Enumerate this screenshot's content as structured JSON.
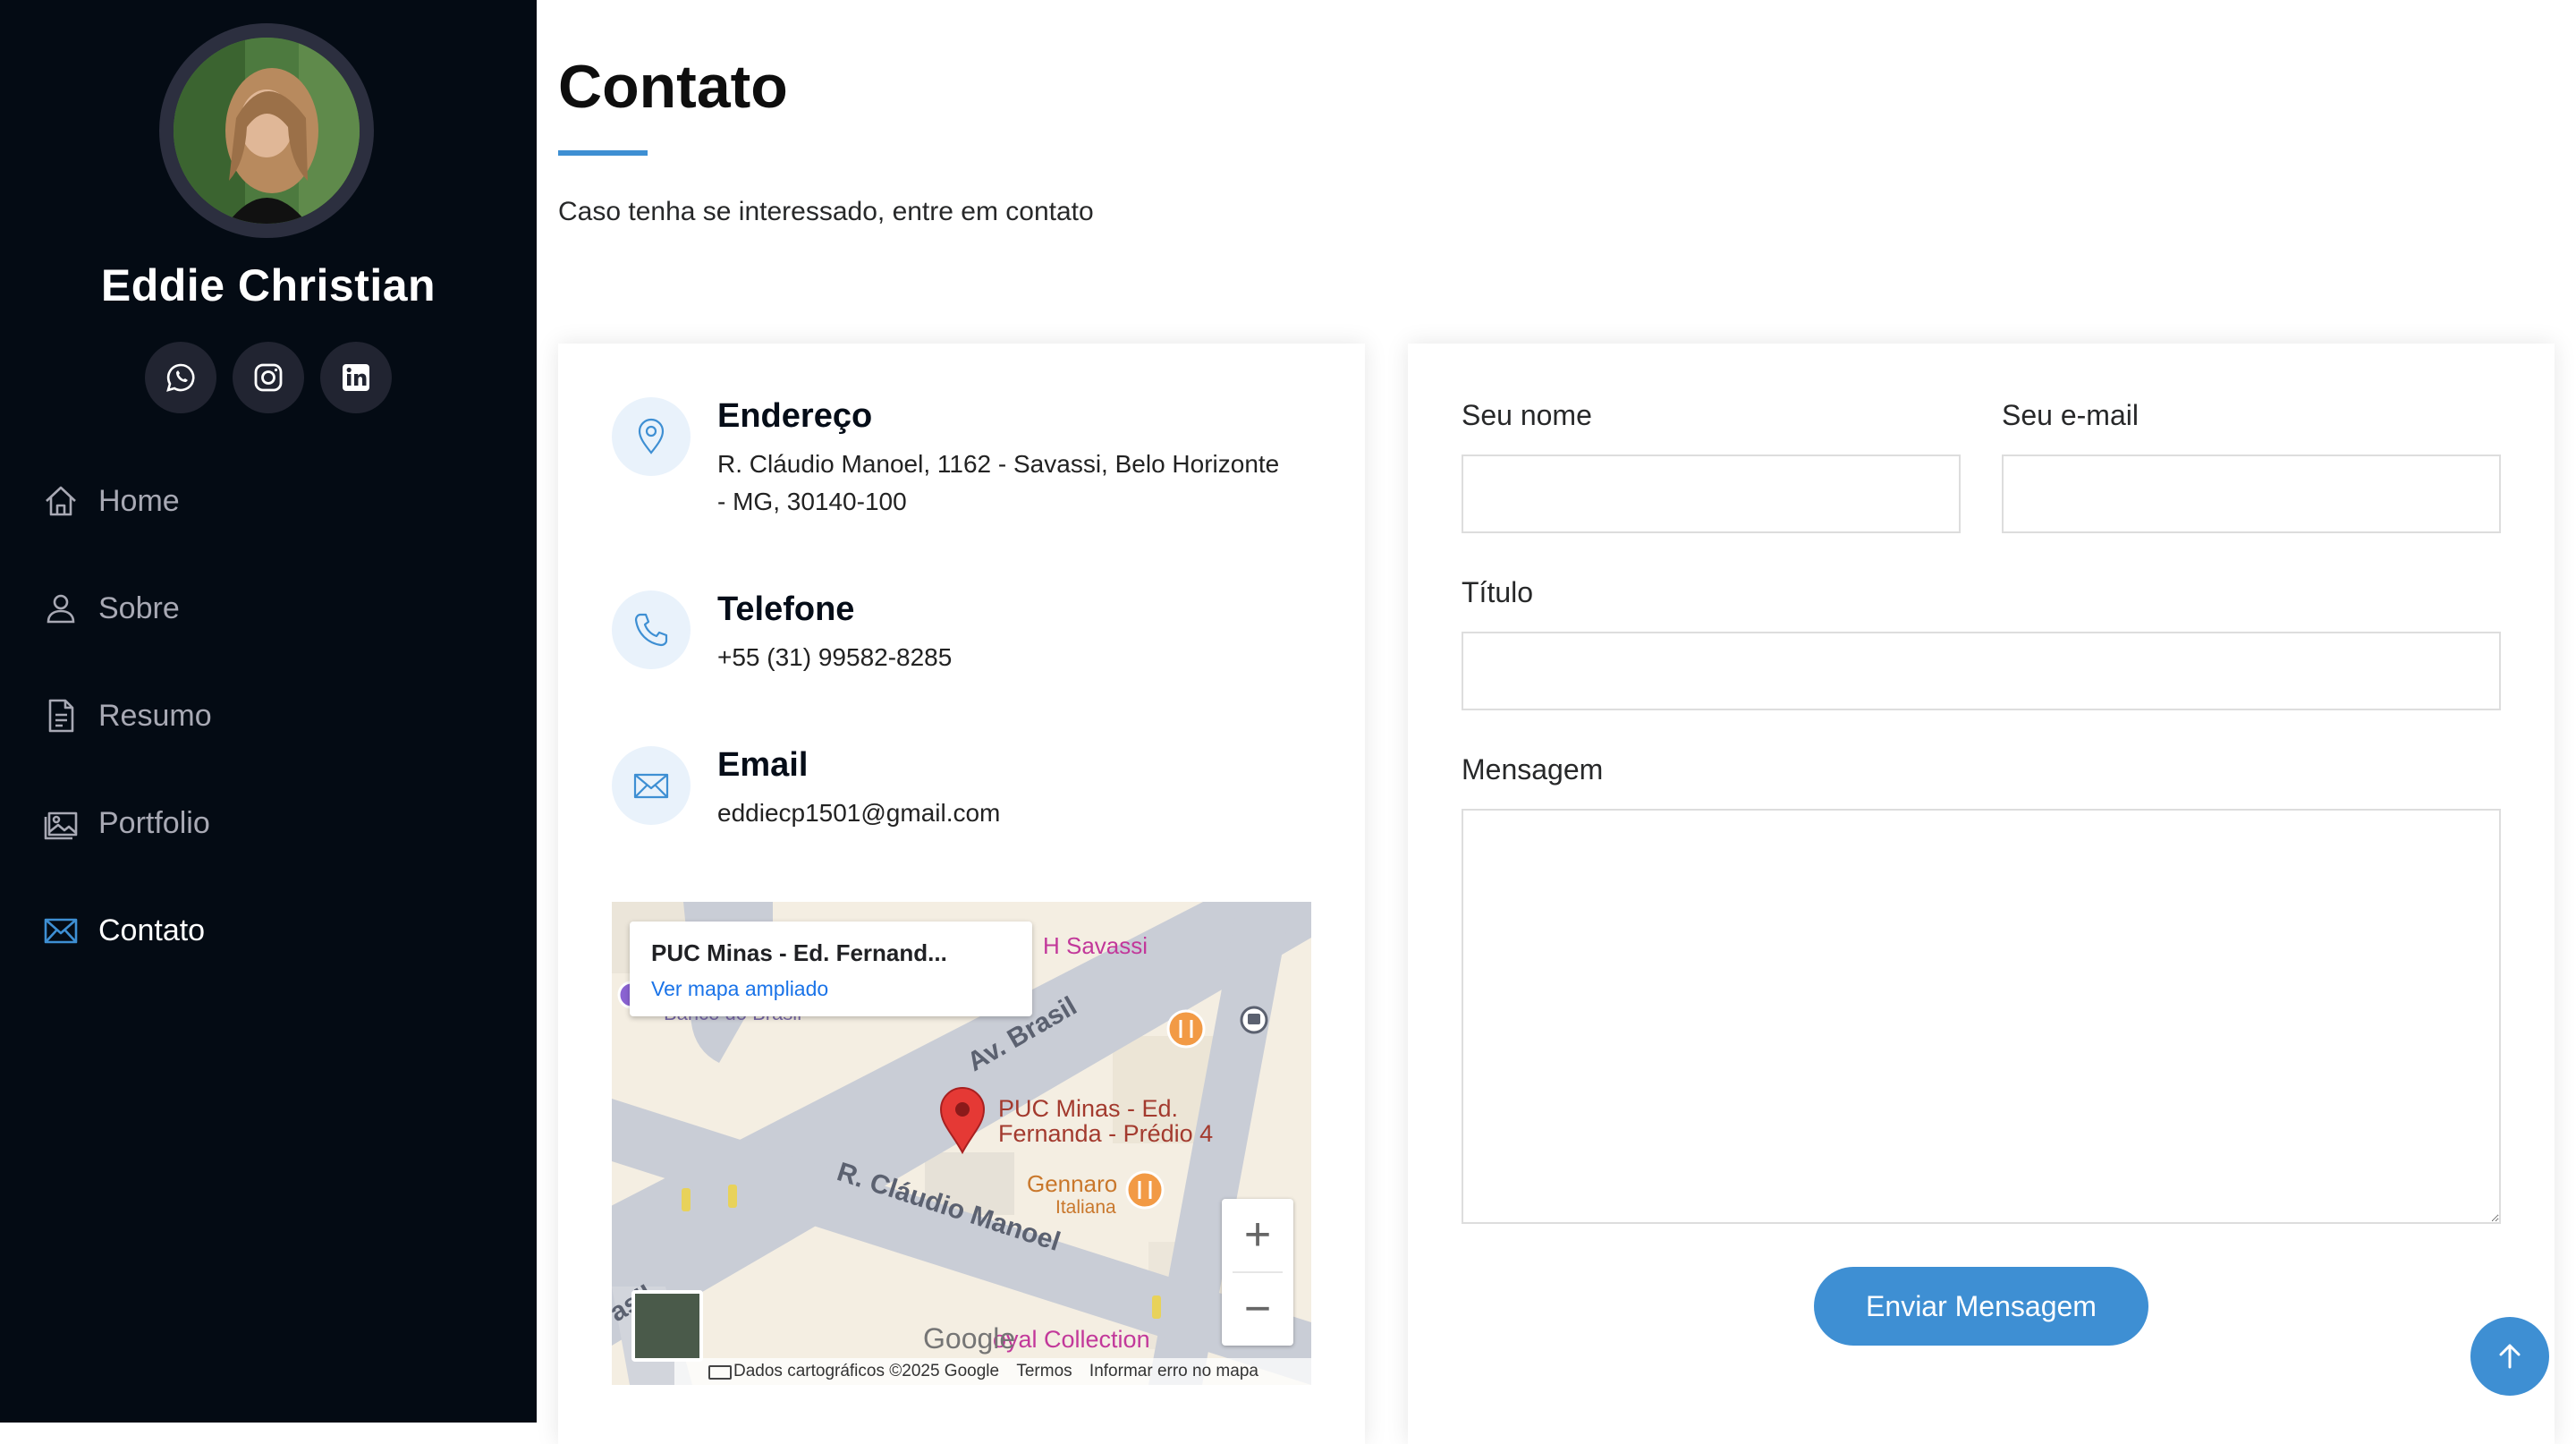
{
  "profile": {
    "name": "Eddie Christian"
  },
  "social": [
    {
      "icon": "whatsapp-icon"
    },
    {
      "icon": "instagram-icon"
    },
    {
      "icon": "linkedin-icon"
    }
  ],
  "nav": {
    "items": [
      {
        "label": "Home",
        "icon": "home-icon",
        "active": false
      },
      {
        "label": "Sobre",
        "icon": "person-icon",
        "active": false
      },
      {
        "label": "Resumo",
        "icon": "file-icon",
        "active": false
      },
      {
        "label": "Portfolio",
        "icon": "images-icon",
        "active": false
      },
      {
        "label": "Contato",
        "icon": "envelope-icon",
        "active": true
      }
    ]
  },
  "contact": {
    "title": "Contato",
    "description": "Caso tenha se interessado, entre em contato",
    "address_title": "Endereço",
    "address_text": "R. Cláudio Manoel, 1162 - Savassi, Belo Horizonte - MG, 30140-100",
    "phone_title": "Telefone",
    "phone_text": "+55 (31) 99582-8285",
    "email_title": "Email",
    "email_text": "eddiecp1501@gmail.com"
  },
  "map": {
    "place_title": "PUC Minas - Ed. Fernand...",
    "view_larger": "Ver mapa ampliado",
    "pin_label_line1": "PUC Minas - Ed.",
    "pin_label_line2": "Fernanda - Prédio 4",
    "poi_savassi": "H Savassi",
    "poi_bank": "Banco do Brasil",
    "poi_gennaro_line1": "Gennaro",
    "poi_gennaro_line2": "Italiana",
    "poi_collection": "oyal Collection",
    "street_brasil": "Av. Brasil",
    "street_claudio": "R. Cláudio Manoel",
    "street_brasil_cut": "asil",
    "google": "Google",
    "footer_data": "Dados cartográficos ©2025 Google",
    "footer_terms": "Termos",
    "footer_report": "Informar erro no mapa",
    "zoom_in": "+",
    "zoom_out": "−"
  },
  "form": {
    "name_label": "Seu nome",
    "email_label": "Seu e-mail",
    "subject_label": "Título",
    "message_label": "Mensagem",
    "name_value": "",
    "email_value": "",
    "subject_value": "",
    "message_value": "",
    "submit_label": "Enviar Mensagem"
  },
  "colors": {
    "sidebar_bg": "#040b14",
    "accent": "#3e8fd3",
    "icon_circle": "#e9f2fb"
  }
}
